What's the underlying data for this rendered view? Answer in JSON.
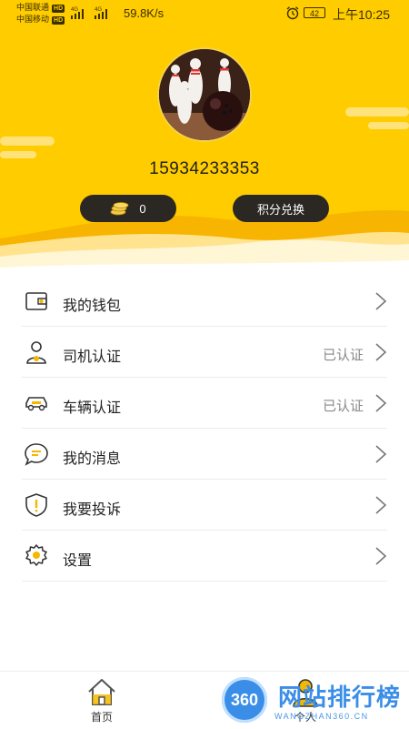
{
  "status_bar": {
    "carrier_1": "中国联通",
    "carrier_2": "中国移动",
    "hd": "HD",
    "net_type": "4G",
    "net_speed": "59.8K/s",
    "battery": "42",
    "time": "上午10:25"
  },
  "profile": {
    "phone": "15934233353",
    "coins": "0",
    "points_exchange": "积分兑换"
  },
  "menu": [
    {
      "icon": "wallet-icon",
      "label": "我的钱包",
      "status": ""
    },
    {
      "icon": "driver-icon",
      "label": "司机认证",
      "status": "已认证"
    },
    {
      "icon": "car-icon",
      "label": "车辆认证",
      "status": "已认证"
    },
    {
      "icon": "message-icon",
      "label": "我的消息",
      "status": ""
    },
    {
      "icon": "complaint-shield-icon",
      "label": "我要投诉",
      "status": ""
    },
    {
      "icon": "settings-gear-icon",
      "label": "设置",
      "status": ""
    }
  ],
  "bottom_nav": {
    "home": "首页",
    "mine": "个人"
  },
  "watermark": {
    "badge": "360",
    "title": "网站排行榜",
    "subtitle": "WANGZHAN360.CN"
  },
  "colors": {
    "header_yellow": "#FFCC00",
    "pill_dark": "#2b2723",
    "accent_yellow": "#F5B800"
  }
}
